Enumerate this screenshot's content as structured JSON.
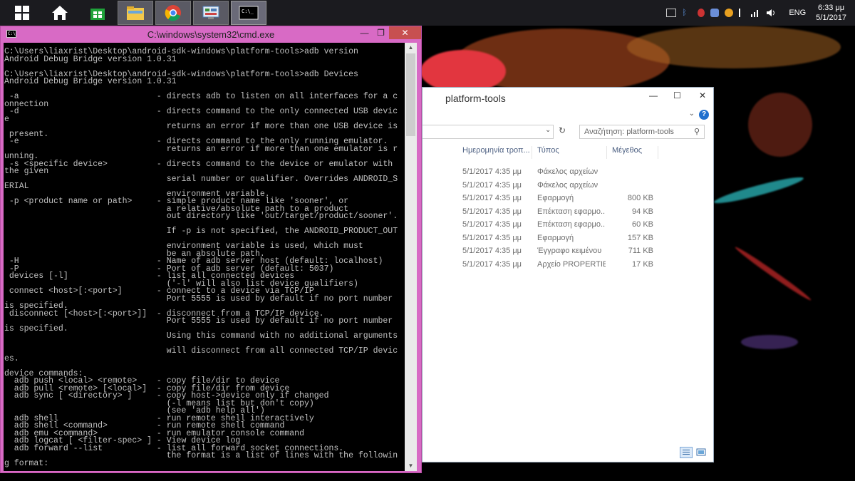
{
  "taskbar": {
    "buttons": [
      {
        "name": "start-button",
        "icon": "windows-logo-icon"
      },
      {
        "name": "home-button",
        "icon": "home-icon"
      },
      {
        "name": "store-button",
        "icon": "store-icon"
      },
      {
        "name": "file-explorer-button",
        "icon": "folder-icon"
      },
      {
        "name": "chrome-button",
        "icon": "chrome-icon"
      },
      {
        "name": "control-panel-button",
        "icon": "control-panel-icon"
      },
      {
        "name": "cmd-button",
        "icon": "cmd-icon"
      }
    ],
    "tray": {
      "language": "ENG",
      "time": "6:33 μμ",
      "date": "5/1/2017"
    }
  },
  "cmd": {
    "title": "C:\\windows\\system32\\cmd.exe",
    "lines": [
      "C:\\Users\\liaxrist\\Desktop\\android-sdk-windows\\platform-tools>adb version",
      "Android Debug Bridge version 1.0.31",
      "",
      "C:\\Users\\liaxrist\\Desktop\\android-sdk-windows\\platform-tools>adb Devices",
      "Android Debug Bridge version 1.0.31",
      "",
      " -a                            - directs adb to listen on all interfaces for a c",
      "onnection",
      " -d                            - directs command to the only connected USB devic",
      "e",
      "                                 returns an error if more than one USB device is",
      " present.",
      " -e                            - directs command to the only running emulator.",
      "                                 returns an error if more than one emulator is r",
      "unning.",
      " -s <specific device>          - directs command to the device or emulator with",
      "the given",
      "                                 serial number or qualifier. Overrides ANDROID_S",
      "ERIAL",
      "                                 environment variable.",
      " -p <product name or path>     - simple product name like 'sooner', or",
      "                                 a relative/absolute path to a product",
      "                                 out directory like 'out/target/product/sooner'.",
      "",
      "                                 If -p is not specified, the ANDROID_PRODUCT_OUT",
      "",
      "                                 environment variable is used, which must",
      "                                 be an absolute path.",
      " -H                            - Name of adb server host (default: localhost)",
      " -P                            - Port of adb server (default: 5037)",
      " devices [-l]                  - list all connected devices",
      "                                 ('-l' will also list device qualifiers)",
      " connect <host>[:<port>]       - connect to a device via TCP/IP",
      "                                 Port 5555 is used by default if no port number",
      "is specified.",
      " disconnect [<host>[:<port>]]  - disconnect from a TCP/IP device.",
      "                                 Port 5555 is used by default if no port number",
      "is specified.",
      "                                 Using this command with no additional arguments",
      "",
      "                                 will disconnect from all connected TCP/IP devic",
      "es.",
      "",
      "device commands:",
      "  adb push <local> <remote>    - copy file/dir to device",
      "  adb pull <remote> [<local>]  - copy file/dir from device",
      "  adb sync [ <directory> ]     - copy host->device only if changed",
      "                                 (-l means list but don't copy)",
      "                                 (see 'adb help all')",
      "  adb shell                    - run remote shell interactively",
      "  adb shell <command>          - run remote shell command",
      "  adb emu <command>            - run emulator console command",
      "  adb logcat [ <filter-spec> ] - View device log",
      "  adb forward --list           - list all forward socket connections.",
      "                                 the format is a list of lines with the followin",
      "g format:"
    ]
  },
  "explorer": {
    "title": "platform-tools",
    "search_placeholder": "Αναζήτηση: platform-tools",
    "columns": {
      "date": "Ημερομηνία τροπ...",
      "type": "Τύπος",
      "size": "Μέγεθος"
    },
    "rows": [
      {
        "date": "5/1/2017 4:35 μμ",
        "type": "Φάκελος αρχείων",
        "size": ""
      },
      {
        "date": "5/1/2017 4:35 μμ",
        "type": "Φάκελος αρχείων",
        "size": ""
      },
      {
        "date": "5/1/2017 4:35 μμ",
        "type": "Εφαρμογή",
        "size": "800 KB"
      },
      {
        "date": "5/1/2017 4:35 μμ",
        "type": "Επέκταση εφαρμο...",
        "size": "94 KB"
      },
      {
        "date": "5/1/2017 4:35 μμ",
        "type": "Επέκταση εφαρμο...",
        "size": "60 KB"
      },
      {
        "date": "5/1/2017 4:35 μμ",
        "type": "Εφαρμογή",
        "size": "157 KB"
      },
      {
        "date": "5/1/2017 4:35 μμ",
        "type": "Έγγραφο κειμένου",
        "size": "711 KB"
      },
      {
        "date": "5/1/2017 4:35 μμ",
        "type": "Αρχείο PROPERTIES",
        "size": "17 KB"
      }
    ]
  },
  "colors": {
    "cmd_frame": "#d86ac5",
    "taskbar": "#1b1b1f"
  }
}
